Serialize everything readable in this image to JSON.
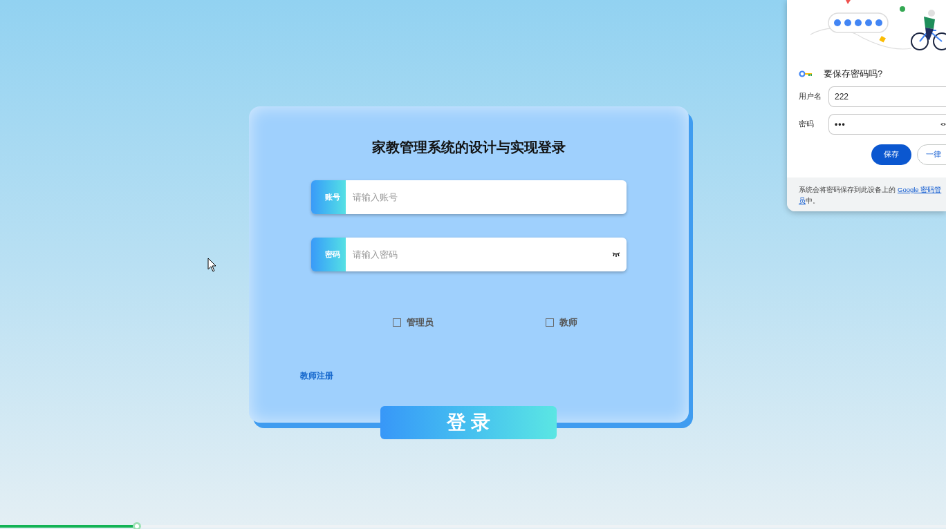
{
  "login_card": {
    "title": "家教管理系统的设计与实现登录",
    "fields": [
      {
        "label": "账号",
        "placeholder": "请输入账号",
        "kind": "text"
      },
      {
        "label": "密码",
        "placeholder": "请输入密码",
        "kind": "password"
      }
    ],
    "roles": [
      {
        "label": "管理员",
        "checked": false
      },
      {
        "label": "教师",
        "checked": false
      }
    ],
    "register_link": "教师注册",
    "login_button": "登 录"
  },
  "save_password_popup": {
    "title": "要保存密码吗?",
    "fields": [
      {
        "label": "用户名",
        "value": "222",
        "kind": "text"
      },
      {
        "label": "密码",
        "value": "•••",
        "kind": "password"
      }
    ],
    "buttons": [
      {
        "label": "保存",
        "kind": "primary"
      },
      {
        "label": "一律",
        "kind": "secondary"
      }
    ],
    "footer": {
      "text": "系统会将密码保存到此设备上的",
      "link": "Google 密码管",
      "link_continued": "员",
      "text_after": "中。"
    }
  },
  "video_progress": {
    "level": 0.145
  }
}
